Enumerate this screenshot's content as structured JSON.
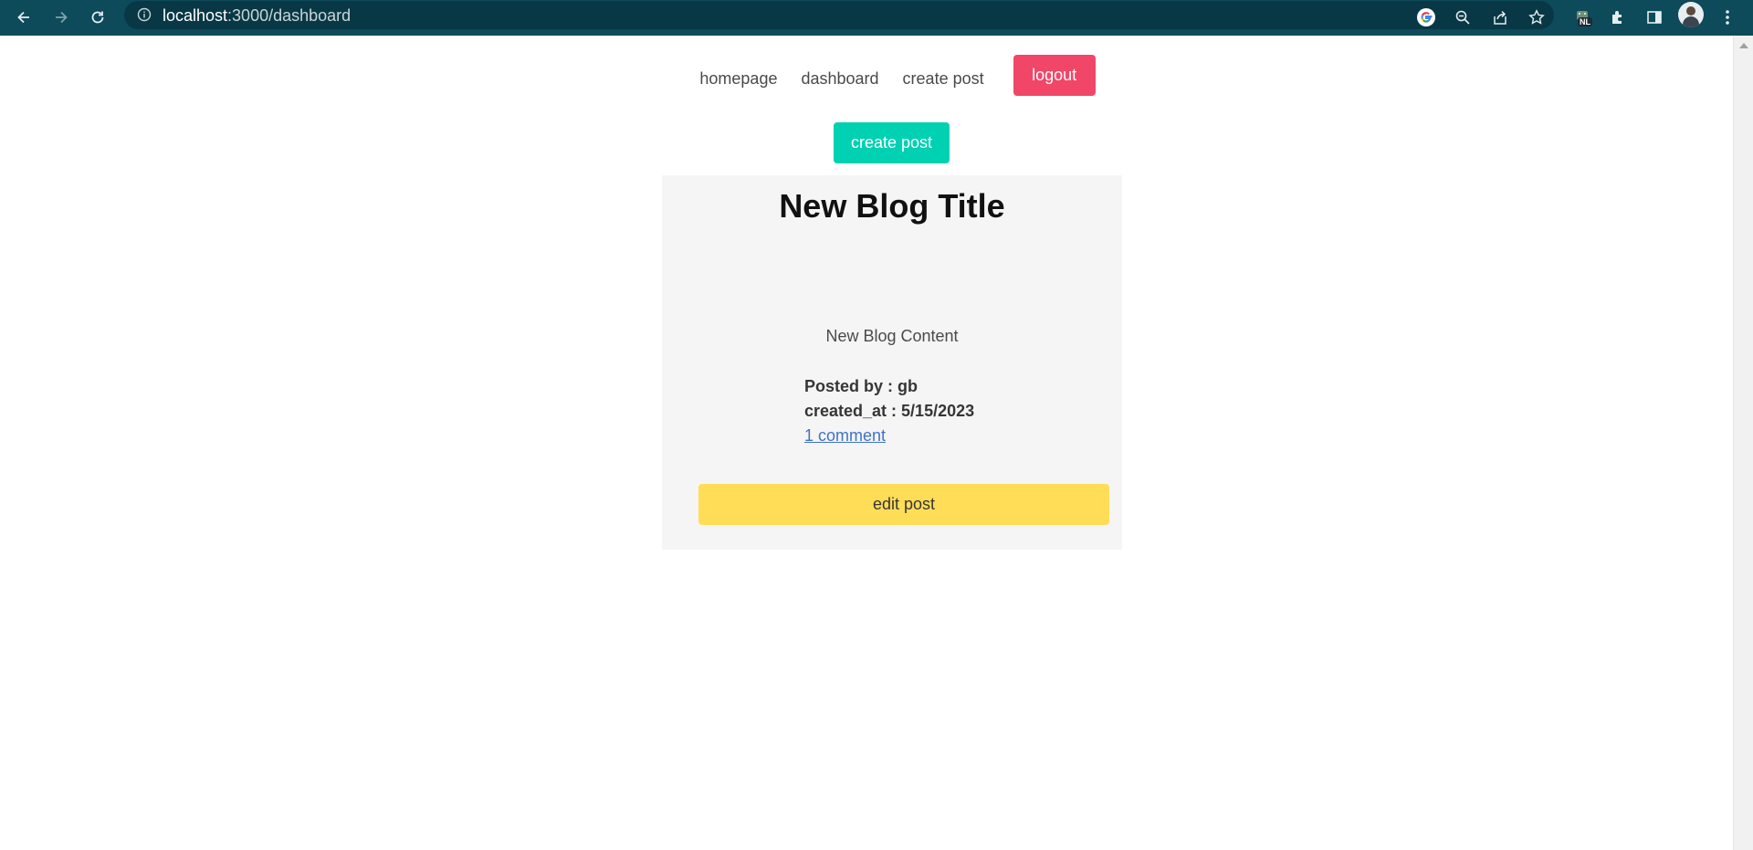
{
  "browser": {
    "url_host": "localhost",
    "url_path": ":3000/dashboard",
    "extension_badge": "NL",
    "icons": [
      "back-icon",
      "forward-icon",
      "reload-icon",
      "info-icon",
      "google-icon",
      "zoom-icon",
      "share-icon",
      "star-icon",
      "extension-icon",
      "puzzle-icon",
      "sidepanel-icon",
      "avatar",
      "menu-icon"
    ]
  },
  "nav": {
    "homepage": "homepage",
    "dashboard": "dashboard",
    "create_post": "create post",
    "logout": "logout"
  },
  "actions": {
    "create_post": "create post"
  },
  "post": {
    "title": "New Blog Title",
    "content": "New Blog Content",
    "posted_by_label": "Posted by : gb",
    "created_at_label": "created_at : 5/15/2023",
    "comments_link": "1 comment",
    "edit_button": "edit post"
  },
  "colors": {
    "chrome": "#0d4a5a",
    "logout": "#f14668",
    "create": "#00d1b2",
    "edit": "#ffdd57",
    "card": "#f5f5f5",
    "link": "#3e73c8"
  }
}
